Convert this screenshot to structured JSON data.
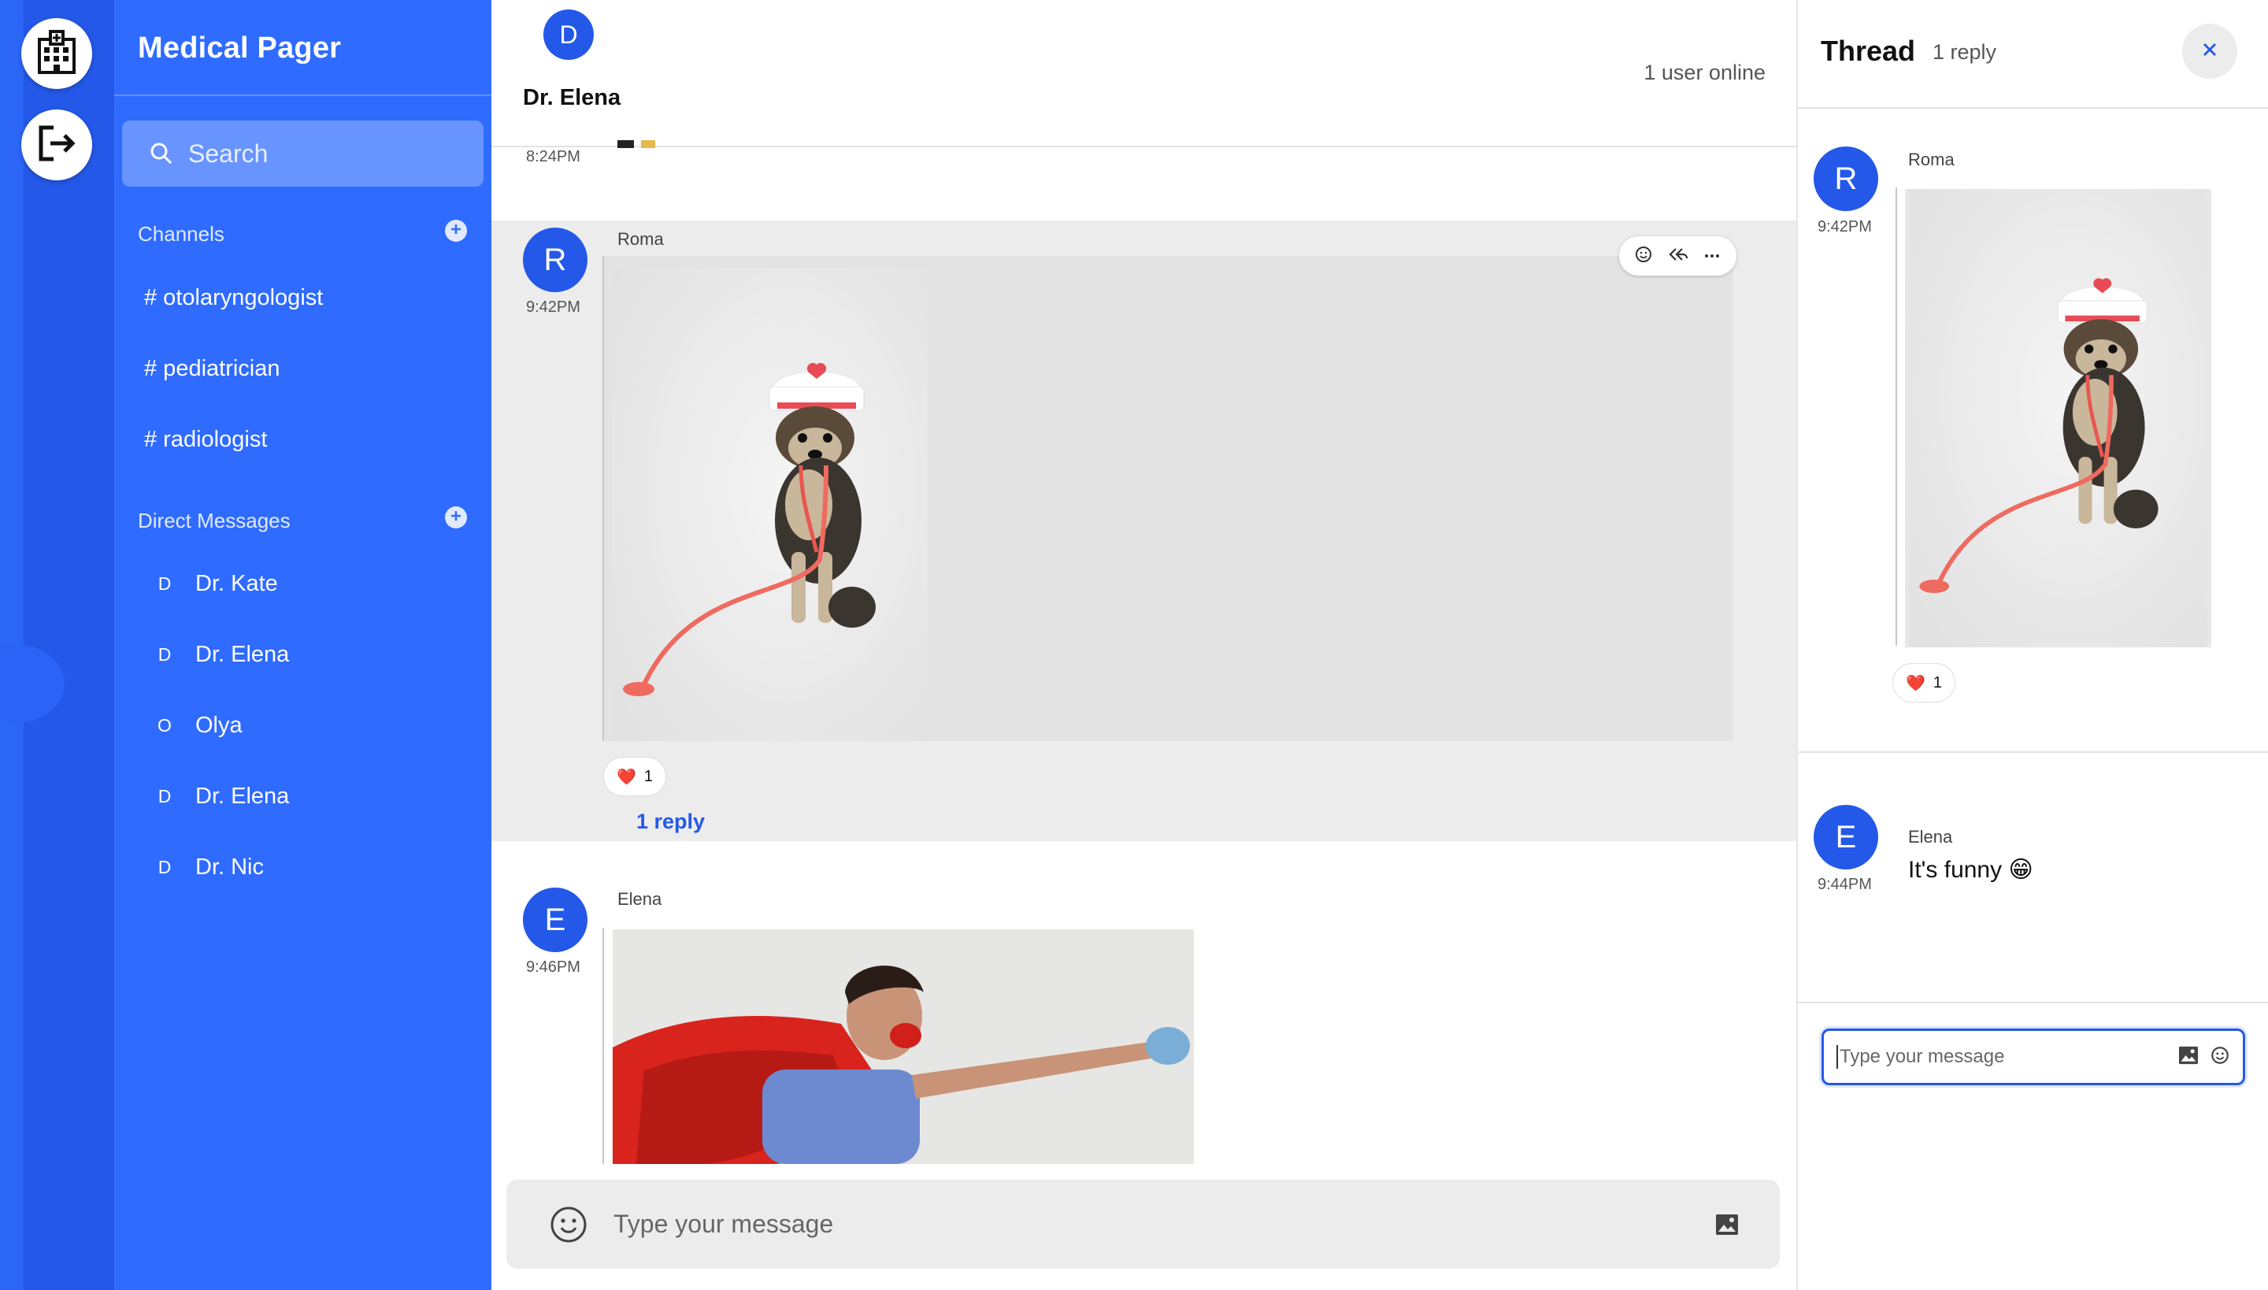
{
  "app": {
    "title": "Medical Pager"
  },
  "sidebar": {
    "search_label": "Search",
    "channels_label": "Channels",
    "channels": [
      "# otolaryngologist",
      "# pediatrician",
      "# radiologist"
    ],
    "dm_label": "Direct Messages",
    "direct_messages": [
      {
        "initial": "D",
        "name": "Dr. Kate"
      },
      {
        "initial": "D",
        "name": "Dr. Elena"
      },
      {
        "initial": "O",
        "name": "Olya"
      },
      {
        "initial": "D",
        "name": "Dr. Elena"
      },
      {
        "initial": "D",
        "name": "Dr. Nic"
      }
    ]
  },
  "channel": {
    "avatar_initial": "D",
    "name": "Dr. Elena",
    "online_status": "1 user online"
  },
  "messages": [
    {
      "time": "8:24PM",
      "text": "Hi 👋"
    },
    {
      "avatar_initial": "R",
      "sender": "Roma",
      "time": "9:42PM",
      "reaction_emoji": "❤️",
      "reaction_count": "1",
      "reply_link": "1 reply"
    },
    {
      "avatar_initial": "E",
      "sender": "Elena",
      "time": "9:46PM"
    }
  ],
  "composer": {
    "placeholder": "Type your message"
  },
  "thread": {
    "title": "Thread",
    "reply_count": "1 reply",
    "parent": {
      "avatar_initial": "R",
      "sender": "Roma",
      "time": "9:42PM",
      "reaction_emoji": "❤️",
      "reaction_count": "1"
    },
    "reply": {
      "avatar_initial": "E",
      "sender": "Elena",
      "time": "9:44PM",
      "text": "It's funny 😁"
    },
    "composer_placeholder": "Type your message"
  },
  "colors": {
    "brand": "#2f6bff",
    "rail": "#2458e8",
    "accent": "#2458e8",
    "highlight_bg": "#ececec"
  },
  "icons": [
    "hospital-icon",
    "logout-icon",
    "search-icon",
    "plus-icon",
    "emoji-icon",
    "reply-icon",
    "more-icon",
    "image-icon",
    "close-icon",
    "heart-icon"
  ]
}
